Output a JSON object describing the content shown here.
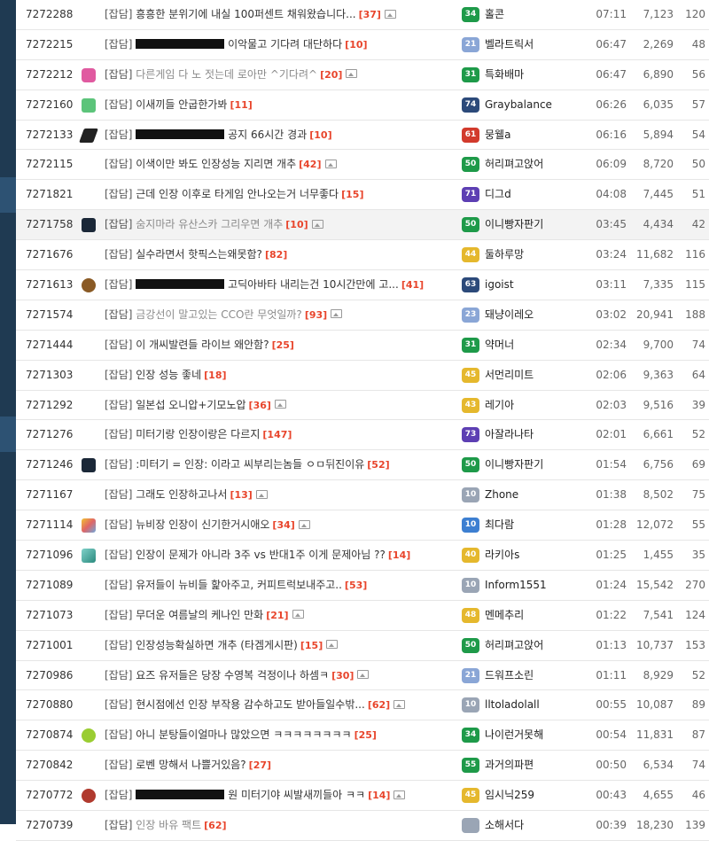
{
  "colors": {
    "comment_count": "#e8452c",
    "level_green": "#1e9a49",
    "level_blue_light": "#8aa6d6",
    "level_gold": "#e5b82d",
    "level_purple": "#5d3fb3",
    "level_gray": "#9aa5b5",
    "level_red": "#d23a2c",
    "level_navy": "#2c4a7a"
  },
  "rows": [
    {
      "num": "7272288",
      "cat": "[잡담]",
      "title": "흥흥한 분위기에 내실 100퍼센트 채워왔습니다...",
      "comments": "[37]",
      "img": true,
      "lvl": "34",
      "lvlColor": "#1e9a49",
      "nick": "홀콘",
      "time": "07:11",
      "views": "7,123",
      "likes": "120",
      "icon": "none",
      "visited": false,
      "blot": false
    },
    {
      "num": "7272215",
      "cat": "[잡담]",
      "title": "이악물고 기다려 대단하다",
      "comments": "[10]",
      "img": false,
      "lvl": "21",
      "lvlColor": "#8aa6d6",
      "nick": "벨라트릭서",
      "time": "06:47",
      "views": "2,269",
      "likes": "48",
      "icon": "none",
      "visited": false,
      "blot": true
    },
    {
      "num": "7272212",
      "cat": "[잡담]",
      "title": "다른게임 다 노 젓는데 로아만 ^기다려^",
      "comments": "[20]",
      "img": true,
      "lvl": "31",
      "lvlColor": "#1e9a49",
      "nick": "특화배마",
      "time": "06:47",
      "views": "6,890",
      "likes": "56",
      "icon": "pink",
      "visited": true,
      "blot": false
    },
    {
      "num": "7272160",
      "cat": "[잡담]",
      "title": "이새끼들 안굽한가봐",
      "comments": "[11]",
      "img": false,
      "lvl": "74",
      "lvlColor": "#2c4a7a",
      "nick": "Graybalance",
      "time": "06:26",
      "views": "6,035",
      "likes": "57",
      "icon": "green",
      "visited": false,
      "blot": false
    },
    {
      "num": "7272133",
      "cat": "[잡담]",
      "title": "공지 66시간 경과",
      "comments": "[10]",
      "img": false,
      "lvl": "61",
      "lvlColor": "#d23a2c",
      "nick": "뭉웰a",
      "time": "06:16",
      "views": "5,894",
      "likes": "54",
      "icon": "dark",
      "visited": false,
      "blot": true
    },
    {
      "num": "7272115",
      "cat": "[잡담]",
      "title": "이색이만 봐도 인장성능 지리면 개추",
      "comments": "[42]",
      "img": true,
      "lvl": "50",
      "lvlColor": "#1e9a49",
      "nick": "허리펴고앉어",
      "time": "06:09",
      "views": "8,720",
      "likes": "50",
      "icon": "none",
      "visited": false,
      "blot": false
    },
    {
      "num": "7271821",
      "cat": "[잡담]",
      "title": "근데 인장 이후로 타게임 안나오는거 너무좋다",
      "comments": "[15]",
      "img": false,
      "lvl": "71",
      "lvlColor": "#5d3fb3",
      "nick": "디그d",
      "time": "04:08",
      "views": "7,445",
      "likes": "51",
      "icon": "none",
      "visited": false,
      "blot": false
    },
    {
      "num": "7271758",
      "cat": "[잡담]",
      "title": "숨지마라 유산스카 그리우면 개추",
      "comments": "[10]",
      "img": true,
      "lvl": "50",
      "lvlColor": "#1e9a49",
      "nick": "이니빵자판기",
      "time": "03:45",
      "views": "4,434",
      "likes": "42",
      "icon": "steam",
      "visited": true,
      "blot": false,
      "hl": true
    },
    {
      "num": "7271676",
      "cat": "[잡담]",
      "title": "실수라면서 핫픽스는왜못함?",
      "comments": "[82]",
      "img": false,
      "lvl": "44",
      "lvlColor": "#e5b82d",
      "nick": "둘하루망",
      "time": "03:24",
      "views": "11,682",
      "likes": "116",
      "icon": "none",
      "visited": false,
      "blot": false
    },
    {
      "num": "7271613",
      "cat": "[잡담]",
      "title": "고딕아바타 내리는건 10시간만에 고...",
      "comments": "[41]",
      "img": false,
      "lvl": "63",
      "lvlColor": "#2c4a7a",
      "nick": "igoist",
      "time": "03:11",
      "views": "7,335",
      "likes": "115",
      "icon": "brown",
      "visited": false,
      "blot": true
    },
    {
      "num": "7271574",
      "cat": "[잡담]",
      "title": "금강선이 말고있는 CCO란 무엇일까?",
      "comments": "[93]",
      "img": true,
      "lvl": "23",
      "lvlColor": "#8aa6d6",
      "nick": "돼냥이레오",
      "time": "03:02",
      "views": "20,941",
      "likes": "188",
      "icon": "none",
      "visited": true,
      "blot": false
    },
    {
      "num": "7271444",
      "cat": "[잡담]",
      "title": "이 개씨발련들 라이브 왜안함?",
      "comments": "[25]",
      "img": false,
      "lvl": "31",
      "lvlColor": "#1e9a49",
      "nick": "약머너",
      "time": "02:34",
      "views": "9,700",
      "likes": "74",
      "icon": "none",
      "visited": false,
      "blot": false
    },
    {
      "num": "7271303",
      "cat": "[잡담]",
      "title": "인장 성능 좋네",
      "comments": "[18]",
      "img": false,
      "lvl": "45",
      "lvlColor": "#e5b82d",
      "nick": "서먼리미트",
      "time": "02:06",
      "views": "9,363",
      "likes": "64",
      "icon": "none",
      "visited": false,
      "blot": false
    },
    {
      "num": "7271292",
      "cat": "[잡담]",
      "title": "일본섭 오니압+기모노압",
      "comments": "[36]",
      "img": true,
      "lvl": "43",
      "lvlColor": "#e5b82d",
      "nick": "레기아",
      "time": "02:03",
      "views": "9,516",
      "likes": "39",
      "icon": "none",
      "visited": false,
      "blot": false
    },
    {
      "num": "7271276",
      "cat": "[잡담]",
      "title": "미터기랑 인장이랑은 다르지",
      "comments": "[147]",
      "img": false,
      "lvl": "73",
      "lvlColor": "#5d3fb3",
      "nick": "아잘라나타",
      "time": "02:01",
      "views": "6,661",
      "likes": "52",
      "icon": "none",
      "visited": false,
      "blot": false
    },
    {
      "num": "7271246",
      "cat": "[잡담]",
      "title": ":미터기 = 인장: 이라고 씨부리는놈들 ㅇㅁ뒤진이유",
      "comments": "[52]",
      "img": false,
      "lvl": "50",
      "lvlColor": "#1e9a49",
      "nick": "이니빵자판기",
      "time": "01:54",
      "views": "6,756",
      "likes": "69",
      "icon": "steam",
      "visited": false,
      "blot": false
    },
    {
      "num": "7271167",
      "cat": "[잡담]",
      "title": "그래도 인장하고나서",
      "comments": "[13]",
      "img": true,
      "lvl": "10",
      "lvlColor": "#9aa5b5",
      "nick": "Zhone",
      "time": "01:38",
      "views": "8,502",
      "likes": "75",
      "icon": "none",
      "visited": false,
      "blot": false
    },
    {
      "num": "7271114",
      "cat": "[잡담]",
      "title": "뉴비장 인장이 신기한거시애오",
      "comments": "[34]",
      "img": true,
      "lvl": "10",
      "lvlColor": "#3d7fd1",
      "nick": "최다람",
      "time": "01:28",
      "views": "12,072",
      "likes": "55",
      "icon": "colorful",
      "visited": false,
      "blot": false
    },
    {
      "num": "7271096",
      "cat": "[잡담]",
      "title": "인장이 문제가 아니라 3주 vs 반대1주 이게 문제아님 ??",
      "comments": "[14]",
      "img": false,
      "lvl": "40",
      "lvlColor": "#e5b82d",
      "nick": "라키아s",
      "time": "01:25",
      "views": "1,455",
      "likes": "35",
      "icon": "teal",
      "visited": false,
      "blot": false
    },
    {
      "num": "7271089",
      "cat": "[잡담]",
      "title": "유저들이 뉴비들 핥아주고, 커피트럭보내주고..",
      "comments": "[53]",
      "img": false,
      "lvl": "10",
      "lvlColor": "#9aa5b5",
      "nick": "Inform1551",
      "time": "01:24",
      "views": "15,542",
      "likes": "270",
      "icon": "none",
      "visited": false,
      "blot": false
    },
    {
      "num": "7271073",
      "cat": "[잡담]",
      "title": "무더운 여름날의 케나인 만화",
      "comments": "[21]",
      "img": true,
      "lvl": "48",
      "lvlColor": "#e5b82d",
      "nick": "멘메추리",
      "time": "01:22",
      "views": "7,541",
      "likes": "124",
      "icon": "none",
      "visited": false,
      "blot": false
    },
    {
      "num": "7271001",
      "cat": "[잡담]",
      "title": "인장성능확실하면 개추 (타겜게시판)",
      "comments": "[15]",
      "img": true,
      "lvl": "50",
      "lvlColor": "#1e9a49",
      "nick": "허리펴고앉어",
      "time": "01:13",
      "views": "10,737",
      "likes": "153",
      "icon": "none",
      "visited": false,
      "blot": false
    },
    {
      "num": "7270986",
      "cat": "[잡담]",
      "title": "요즈 유저들은 당장 수영복 걱정이나 하셈ㅋ",
      "comments": "[30]",
      "img": true,
      "lvl": "21",
      "lvlColor": "#8aa6d6",
      "nick": "드워프소린",
      "time": "01:11",
      "views": "8,929",
      "likes": "52",
      "icon": "none",
      "visited": false,
      "blot": false
    },
    {
      "num": "7270880",
      "cat": "[잡담]",
      "title": "현시점에선 인장 부작용 감수하고도 받아들일수밖...",
      "comments": "[62]",
      "img": true,
      "lvl": "10",
      "lvlColor": "#9aa5b5",
      "nick": "lltoladolall",
      "time": "00:55",
      "views": "10,087",
      "likes": "89",
      "icon": "none",
      "visited": false,
      "blot": false
    },
    {
      "num": "7270874",
      "cat": "[잡담]",
      "title": "아니 분탕들이얼마나 많았으면 ㅋㅋㅋㅋㅋㅋㅋㅋ",
      "comments": "[25]",
      "img": false,
      "lvl": "34",
      "lvlColor": "#1e9a49",
      "nick": "나이런거못해",
      "time": "00:54",
      "views": "11,831",
      "likes": "87",
      "icon": "lime",
      "visited": false,
      "blot": false
    },
    {
      "num": "7270842",
      "cat": "[잡담]",
      "title": "로벤 망해서 나쁠거있음?",
      "comments": "[27]",
      "img": false,
      "lvl": "55",
      "lvlColor": "#1e9a49",
      "nick": "과거의파편",
      "time": "00:50",
      "views": "6,534",
      "likes": "74",
      "icon": "none",
      "visited": false,
      "blot": false
    },
    {
      "num": "7270772",
      "cat": "[잡담]",
      "title": "원 미터기야 씨발새끼들아 ㅋㅋ",
      "comments": "[14]",
      "img": true,
      "lvl": "45",
      "lvlColor": "#e5b82d",
      "nick": "임시닉259",
      "time": "00:43",
      "views": "4,655",
      "likes": "46",
      "icon": "red",
      "visited": false,
      "blot": true
    },
    {
      "num": "7270739",
      "cat": "[잡담]",
      "title": "인장 바유 팩트",
      "comments": "[62]",
      "img": false,
      "lvl": "",
      "lvlColor": "#9aa5b5",
      "nick": "소해서다",
      "time": "00:39",
      "views": "18,230",
      "likes": "139",
      "icon": "none",
      "visited": true,
      "blot": false
    }
  ]
}
